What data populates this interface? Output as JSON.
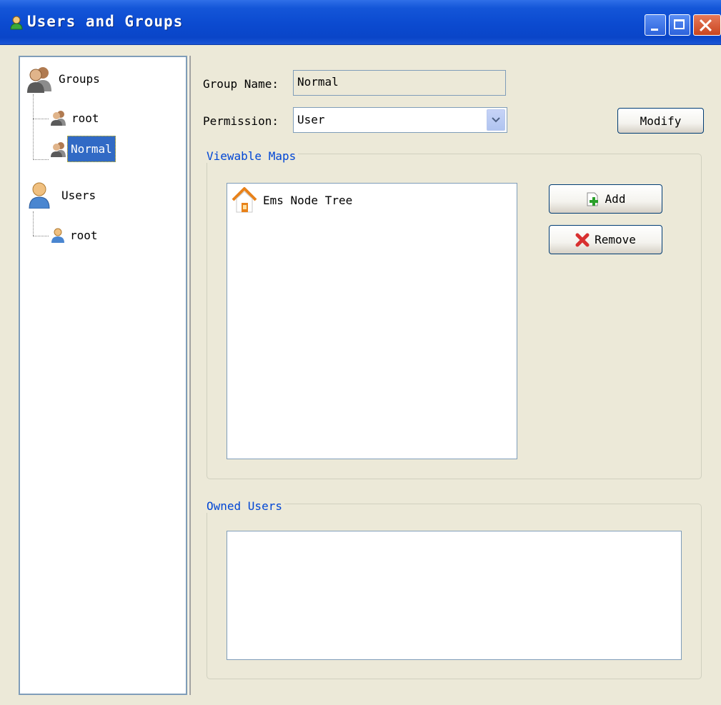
{
  "window": {
    "title": "Users and Groups",
    "icon": "user-icon",
    "controls": [
      "minimize-icon",
      "maximize-icon",
      "close-icon"
    ]
  },
  "tree": {
    "groups_label": "Groups",
    "groups": [
      {
        "label": "root",
        "selected": false
      },
      {
        "label": "Normal",
        "selected": true
      }
    ],
    "users_label": "Users",
    "users": [
      {
        "label": "root"
      }
    ]
  },
  "form": {
    "group_name_label": "Group Name:",
    "group_name_value": "Normal",
    "permission_label": "Permission:",
    "permission_value": "User",
    "modify_label": "Modify"
  },
  "viewable_maps": {
    "title": "Viewable Maps",
    "items": [
      {
        "label": "Ems Node Tree",
        "icon": "home-icon"
      }
    ],
    "add_label": "Add",
    "remove_label": "Remove"
  },
  "owned_users": {
    "title": "Owned Users",
    "items": []
  },
  "colors": {
    "titlebar": "#0a45c8",
    "window_bg": "#ece9d8",
    "selection": "#316ac5",
    "groupbox_title": "#0046d5"
  }
}
